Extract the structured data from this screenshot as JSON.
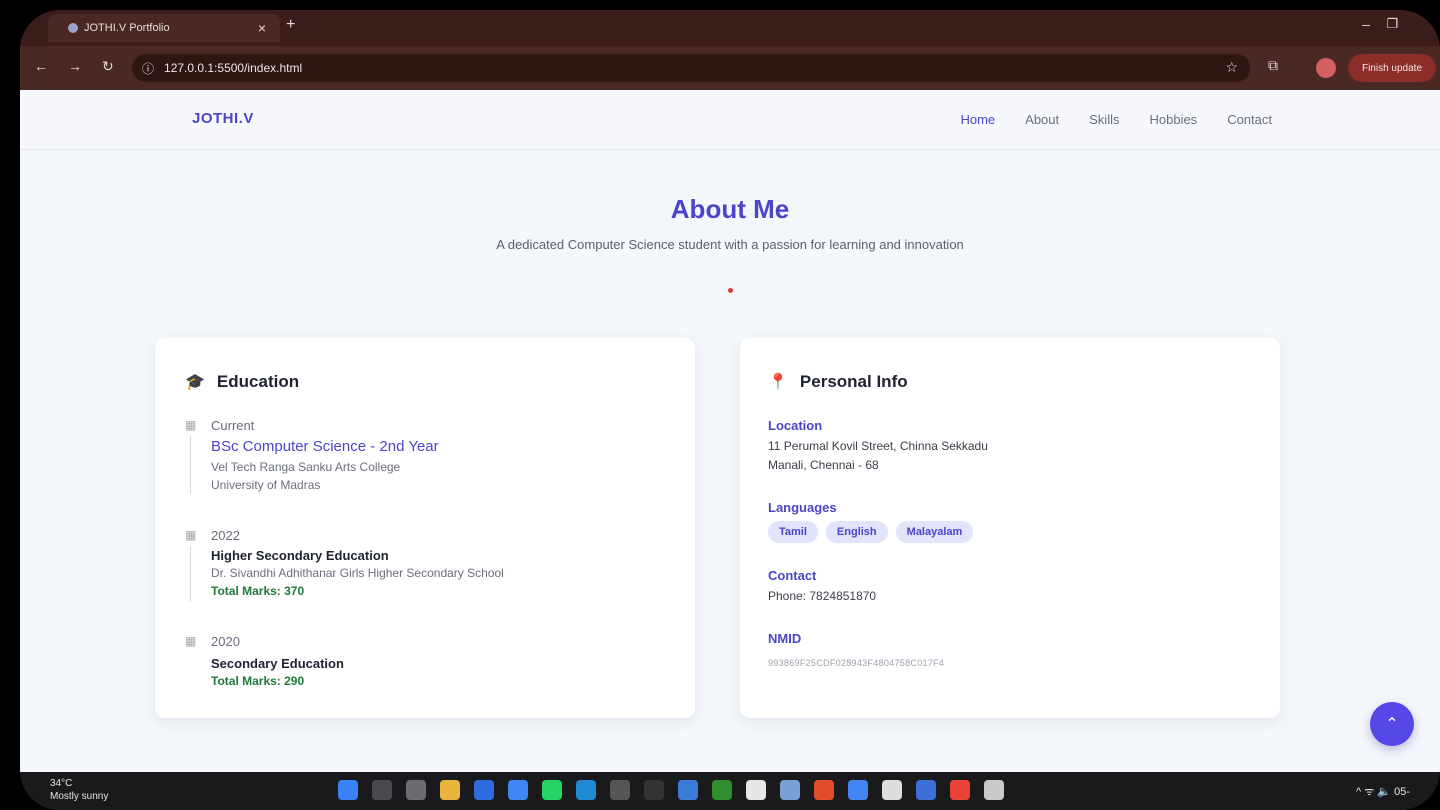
{
  "browser": {
    "tab_title": "JOTHI.V Portfolio",
    "tab_close": "×",
    "new_tab": "+",
    "url": "127.0.0.1:5500/index.html",
    "update_label": "Finish update"
  },
  "nav": {
    "brand": "JOTHI.V",
    "links": [
      "Home",
      "About",
      "Skills",
      "Hobbies",
      "Contact"
    ]
  },
  "about": {
    "title": "About Me",
    "subtitle": "A dedicated Computer Science student with a passion for learning and innovation"
  },
  "education": {
    "heading": "Education",
    "items": [
      {
        "year": "Current",
        "degree": "BSc Computer Science - 2nd Year",
        "inst1": "Vel Tech Ranga Sanku Arts College",
        "inst2": "University of Madras"
      },
      {
        "year": "2022",
        "degree": "Higher Secondary Education",
        "inst1": "Dr. Sivandhi Adhithanar Girls Higher Secondary School",
        "marks": "Total Marks: 370"
      },
      {
        "year": "2020",
        "degree": "Secondary Education",
        "marks": "Total Marks: 290"
      }
    ]
  },
  "personal": {
    "heading": "Personal Info",
    "location_label": "Location",
    "location_line1": "11 Perumal Kovil Street, Chinna Sekkadu",
    "location_line2": "Manali, Chennai - 68",
    "languages_label": "Languages",
    "languages": [
      "Tamil",
      "English",
      "Malayalam"
    ],
    "contact_label": "Contact",
    "phone": "Phone: 7824851870",
    "nmid_label": "NMID",
    "nmid": "993869F25CDF028943F4804758C017F4"
  },
  "taskbar": {
    "temp": "34°C",
    "weather": "Mostly sunny",
    "clock": "05-"
  },
  "colors": {
    "accent": "#4c45c9",
    "green": "#1f7a3a",
    "fab": "#5548e6"
  }
}
